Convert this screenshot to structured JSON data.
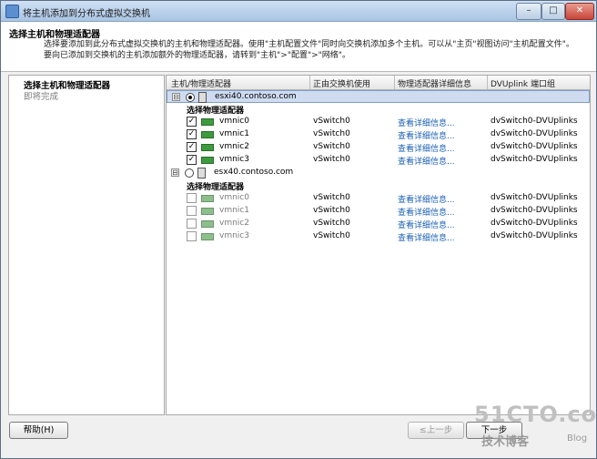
{
  "window": {
    "title": "将主机添加到分布式虚拟交换机",
    "controls": {
      "minimize": "–",
      "maximize": "□",
      "close": "✕"
    }
  },
  "header": {
    "title": "选择主机和物理适配器",
    "description": "选择要添加到此分布式虚拟交换机的主机和物理适配器。使用\"主机配置文件\"同时向交换机添加多个主机。可以从\"主页\"视图访问\"主机配置文件\"。要向已添加到交换机的主机添加额外的物理适配器，请转到\"主机\">\"配置\">\"网络\"。"
  },
  "steps": [
    {
      "label": "选择主机和物理适配器",
      "active": true
    },
    {
      "label": "即将完成",
      "active": false
    }
  ],
  "table": {
    "columns": [
      "主机/物理适配器",
      "正由交换机使用",
      "物理适配器详细信息",
      "DVUplink 端口组"
    ],
    "hosts": [
      {
        "name": "esxi40.contoso.com",
        "expander": "⊟",
        "selected": true,
        "group_label": "选择物理适配器",
        "adapters": [
          {
            "name": "vmnic0",
            "switch": "vSwitch0",
            "details": "查看详细信息...",
            "uplink": "dvSwitch0-DVUplinks",
            "checked": true
          },
          {
            "name": "vmnic1",
            "switch": "vSwitch0",
            "details": "查看详细信息...",
            "uplink": "dvSwitch0-DVUplinks",
            "checked": true
          },
          {
            "name": "vmnic2",
            "switch": "vSwitch0",
            "details": "查看详细信息...",
            "uplink": "dvSwitch0-DVUplinks",
            "checked": true
          },
          {
            "name": "vmnic3",
            "switch": "vSwitch0",
            "details": "查看详细信息...",
            "uplink": "dvSwitch0-DVUplinks",
            "checked": true
          }
        ]
      },
      {
        "name": "esx40.contoso.com",
        "expander": "⊟",
        "selected": false,
        "group_label": "选择物理适配器",
        "adapters": [
          {
            "name": "vmnic0",
            "switch": "vSwitch0",
            "details": "查看详细信息...",
            "uplink": "dvSwitch0-DVUplinks",
            "checked": false
          },
          {
            "name": "vmnic1",
            "switch": "vSwitch0",
            "details": "查看详细信息...",
            "uplink": "dvSwitch0-DVUplinks",
            "checked": false
          },
          {
            "name": "vmnic2",
            "switch": "vSwitch0",
            "details": "查看详细信息...",
            "uplink": "dvSwitch0-DVUplinks",
            "checked": false
          },
          {
            "name": "vmnic3",
            "switch": "vSwitch0",
            "details": "查看详细信息...",
            "uplink": "dvSwitch0-DVUplinks",
            "checked": false
          }
        ]
      }
    ]
  },
  "footer": {
    "help": "帮助(H)",
    "back": "≤上一步",
    "next": "下一步"
  },
  "watermark": {
    "main": "51CTO.com",
    "sub": "技术博客",
    "blog": "Blog"
  },
  "icons": {
    "checked_mark": "✓"
  }
}
